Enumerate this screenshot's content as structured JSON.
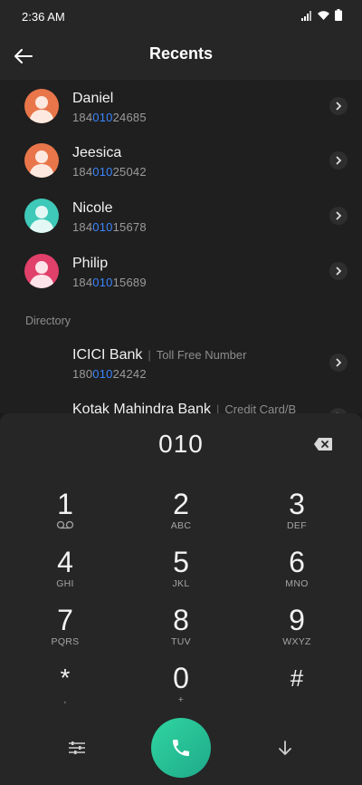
{
  "status_bar": {
    "time": "2:36 AM"
  },
  "app_bar": {
    "title": "Recents"
  },
  "contacts": [
    {
      "name": "Daniel",
      "number_pre": "184",
      "number_match": "010",
      "number_post": "24685",
      "avatar_color": "#e8764a"
    },
    {
      "name": "Jeesica",
      "number_pre": "184",
      "number_match": "010",
      "number_post": "25042",
      "avatar_color": "#e8764a"
    },
    {
      "name": "Nicole",
      "number_pre": "184",
      "number_match": "010",
      "number_post": "15678",
      "avatar_color": "#3ec9b8"
    },
    {
      "name": "Philip",
      "number_pre": "184",
      "number_match": "010",
      "number_post": "15689",
      "avatar_color": "#e0406a"
    }
  ],
  "directory": {
    "header": "Directory",
    "items": [
      {
        "name": "ICICI Bank",
        "tag": "Toll Free Number",
        "number_pre": "180",
        "number_match": "010",
        "number_post": "24242"
      },
      {
        "name": "Kotak Mahindra Bank",
        "tag": "Credit Card/B"
      }
    ]
  },
  "dialpad": {
    "dialed": "010",
    "keys": [
      {
        "digit": "1",
        "letters": ""
      },
      {
        "digit": "2",
        "letters": "ABC"
      },
      {
        "digit": "3",
        "letters": "DEF"
      },
      {
        "digit": "4",
        "letters": "GHI"
      },
      {
        "digit": "5",
        "letters": "JKL"
      },
      {
        "digit": "6",
        "letters": "MNO"
      },
      {
        "digit": "7",
        "letters": "PQRS"
      },
      {
        "digit": "8",
        "letters": "TUV"
      },
      {
        "digit": "9",
        "letters": "WXYZ"
      },
      {
        "digit": "*",
        "letters": ","
      },
      {
        "digit": "0",
        "letters": "+"
      },
      {
        "digit": "#",
        "letters": ""
      }
    ]
  },
  "colors": {
    "accent": "#3a86ff",
    "call": "#2fc79a"
  }
}
